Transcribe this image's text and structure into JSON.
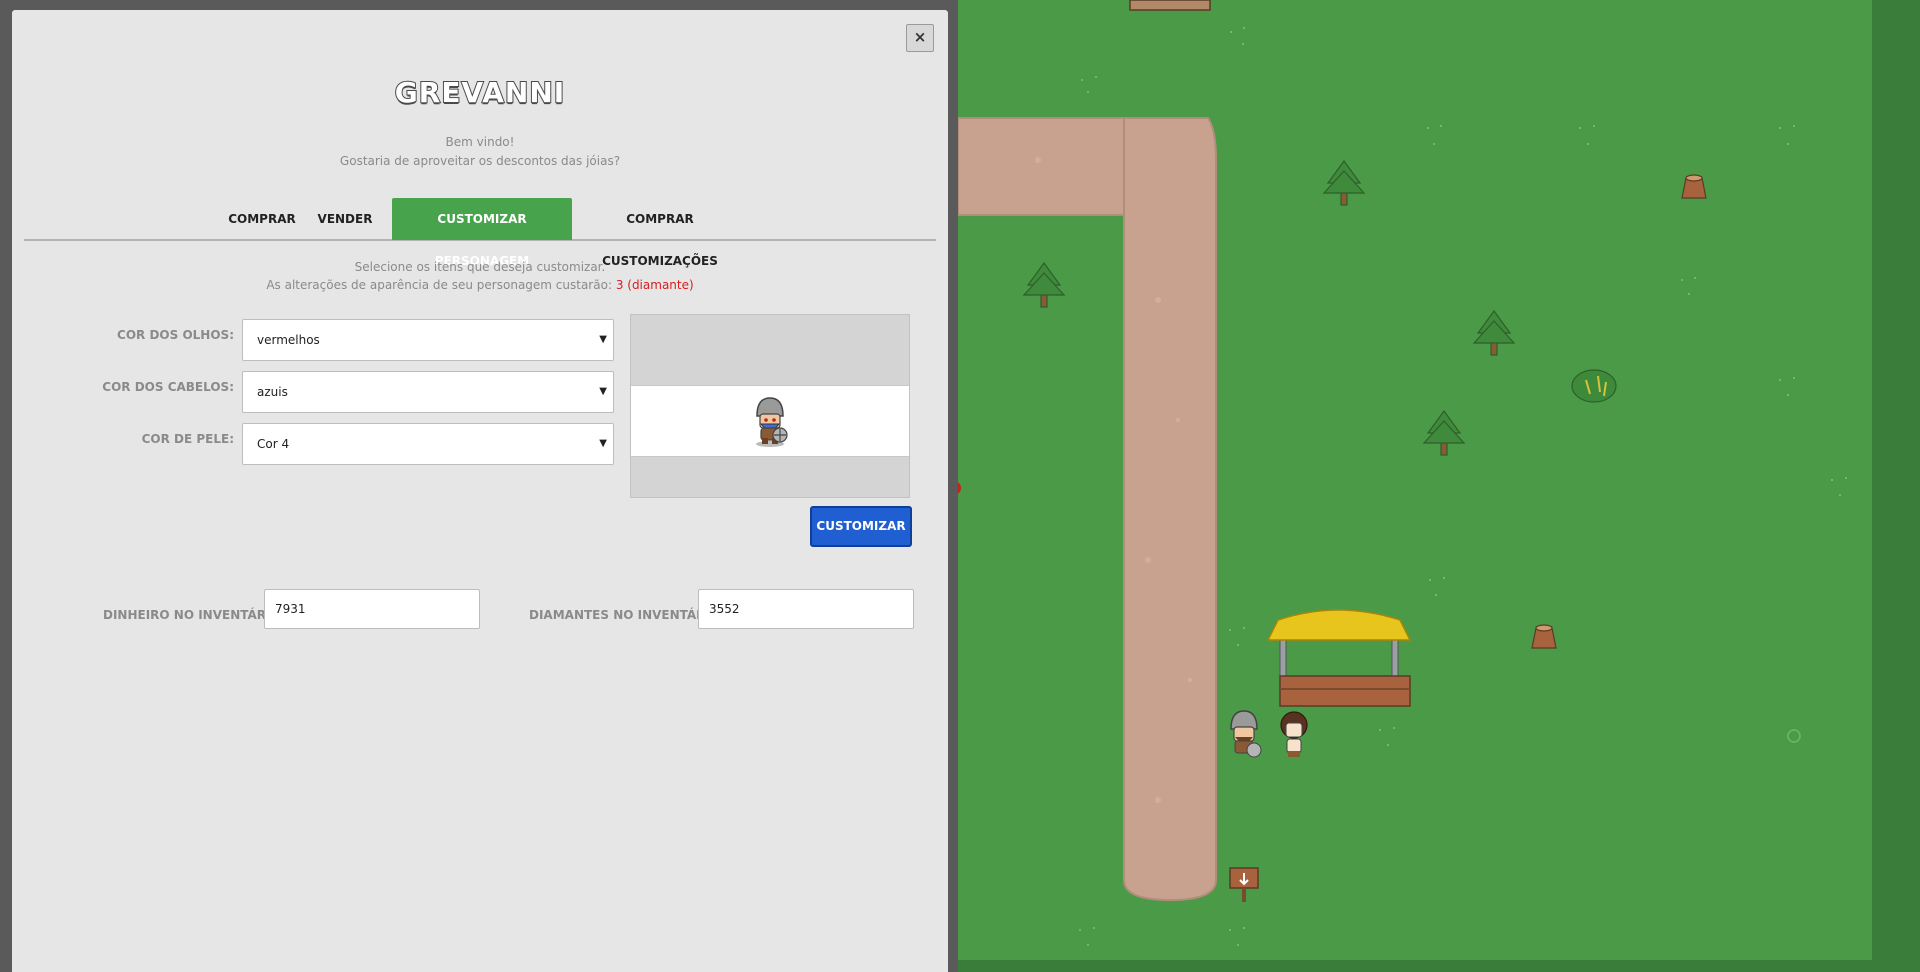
{
  "modal": {
    "close_label": "×",
    "npc_name": "GREVANNI",
    "greeting_line1": "Bem vindo!",
    "greeting_line2": "Gostaria de aproveitar os descontos das jóias?"
  },
  "tabs": [
    {
      "label": "COMPRAR",
      "active": false
    },
    {
      "label": "VENDER",
      "active": false
    },
    {
      "label": "CUSTOMIZAR PERSONAGEM",
      "active": true
    },
    {
      "label": "COMPRAR CUSTOMIZAÇÕES",
      "active": false
    }
  ],
  "customize": {
    "instruction_line1": "Selecione os itens que deseja customizar.",
    "instruction_line2": "As alterações de aparência de seu personagem custarão:",
    "cost_value": "3 (diamante)",
    "fields": [
      {
        "label": "COR DOS OLHOS:",
        "value": "vermelhos"
      },
      {
        "label": "COR DOS CABELOS:",
        "value": "azuis"
      },
      {
        "label": "COR DE PELE:",
        "value": "Cor 4"
      }
    ],
    "button_label": "CUSTOMIZAR"
  },
  "inventory": {
    "money_label": "DINHEIRO NO INVENTÁRIO:",
    "money_value": "7931",
    "diamonds_label": "DIAMANTES NO INVENTÁRIO:",
    "diamonds_value": "3552"
  },
  "colors": {
    "active_tab": "#47a34c",
    "customize_button": "#1f5fd1",
    "cost_text": "#d61f1f",
    "grass": "#4a9a48",
    "path": "#c9a28f",
    "stall_roof": "#e8c51c"
  }
}
